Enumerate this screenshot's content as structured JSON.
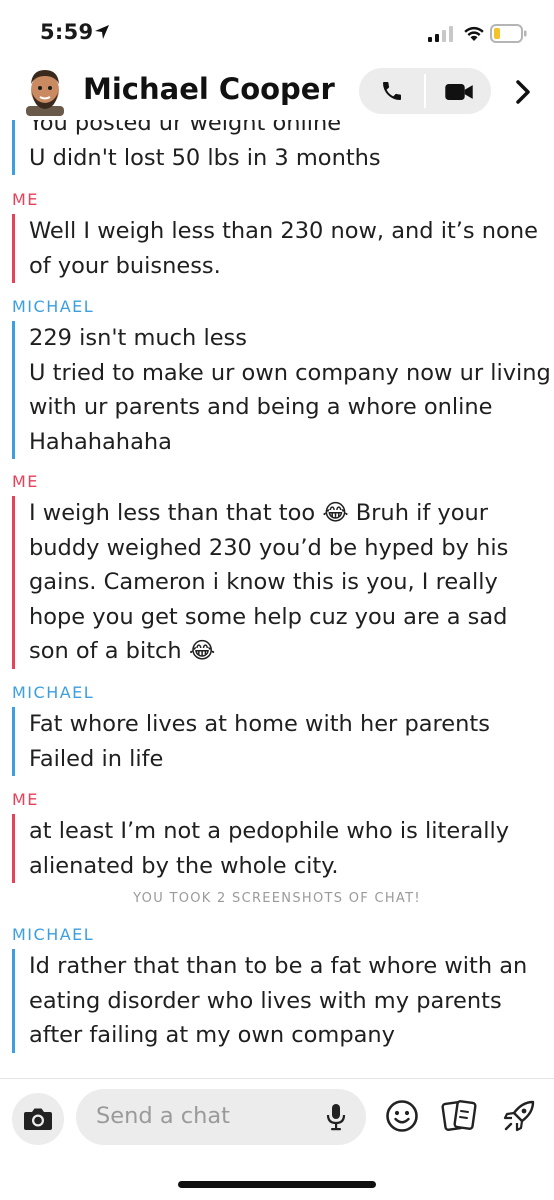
{
  "status_bar": {
    "time": "5:59",
    "icons": [
      "location-arrow-icon",
      "signal-icon",
      "wifi-icon",
      "battery-icon"
    ]
  },
  "header": {
    "contact_name": "Michael Cooper",
    "icons": [
      "bitmoji-avatar",
      "phone-icon",
      "video-icon",
      "chevron-right-icon"
    ]
  },
  "chat": {
    "messages": [
      {
        "sender": "",
        "side": "them",
        "lines": [
          "You posted ur weight online",
          "U didn't lost 50 lbs in 3 months"
        ]
      },
      {
        "sender": "ME",
        "side": "me",
        "lines": [
          "Well I weigh less than 230 now, and it’s none",
          "of your buisness."
        ]
      },
      {
        "sender": "MICHAEL",
        "side": "them",
        "lines": [
          "229 isn't much less",
          "U tried to make ur own company now ur living",
          "with ur parents and being a whore online",
          "Hahahahaha"
        ]
      },
      {
        "sender": "ME",
        "side": "me",
        "lines": [
          "I weigh less than that too 😂 Bruh if your",
          "buddy weighed 230 you’d be hyped by his",
          "gains. Cameron i know this is you, I really",
          "hope you get some help cuz you are a sad",
          "son of a bitch 😂"
        ]
      },
      {
        "sender": "MICHAEL",
        "side": "them",
        "lines": [
          "Fat whore lives at home with her parents",
          "Failed in life"
        ]
      },
      {
        "sender": "ME",
        "side": "me",
        "lines": [
          "at least I’m not a pedophile who is literally",
          "alienated by the whole city."
        ]
      },
      {
        "sender": "MICHAEL",
        "side": "them",
        "lines": [
          "Id rather that than to be a fat whore with an",
          "eating disorder who lives with my parents",
          "after failing at my own company"
        ]
      }
    ],
    "system_note": "YOU TOOK 2 SCREENSHOTS OF CHAT!"
  },
  "composer": {
    "placeholder": "Send a chat",
    "icons": [
      "camera-icon",
      "microphone-icon",
      "smiley-icon",
      "cards-icon",
      "rocket-icon"
    ]
  },
  "colors": {
    "me_accent": "#e8415a",
    "them_accent": "#3c9fe0",
    "pill_background": "#ececec",
    "system_text": "#9a9a9a"
  }
}
